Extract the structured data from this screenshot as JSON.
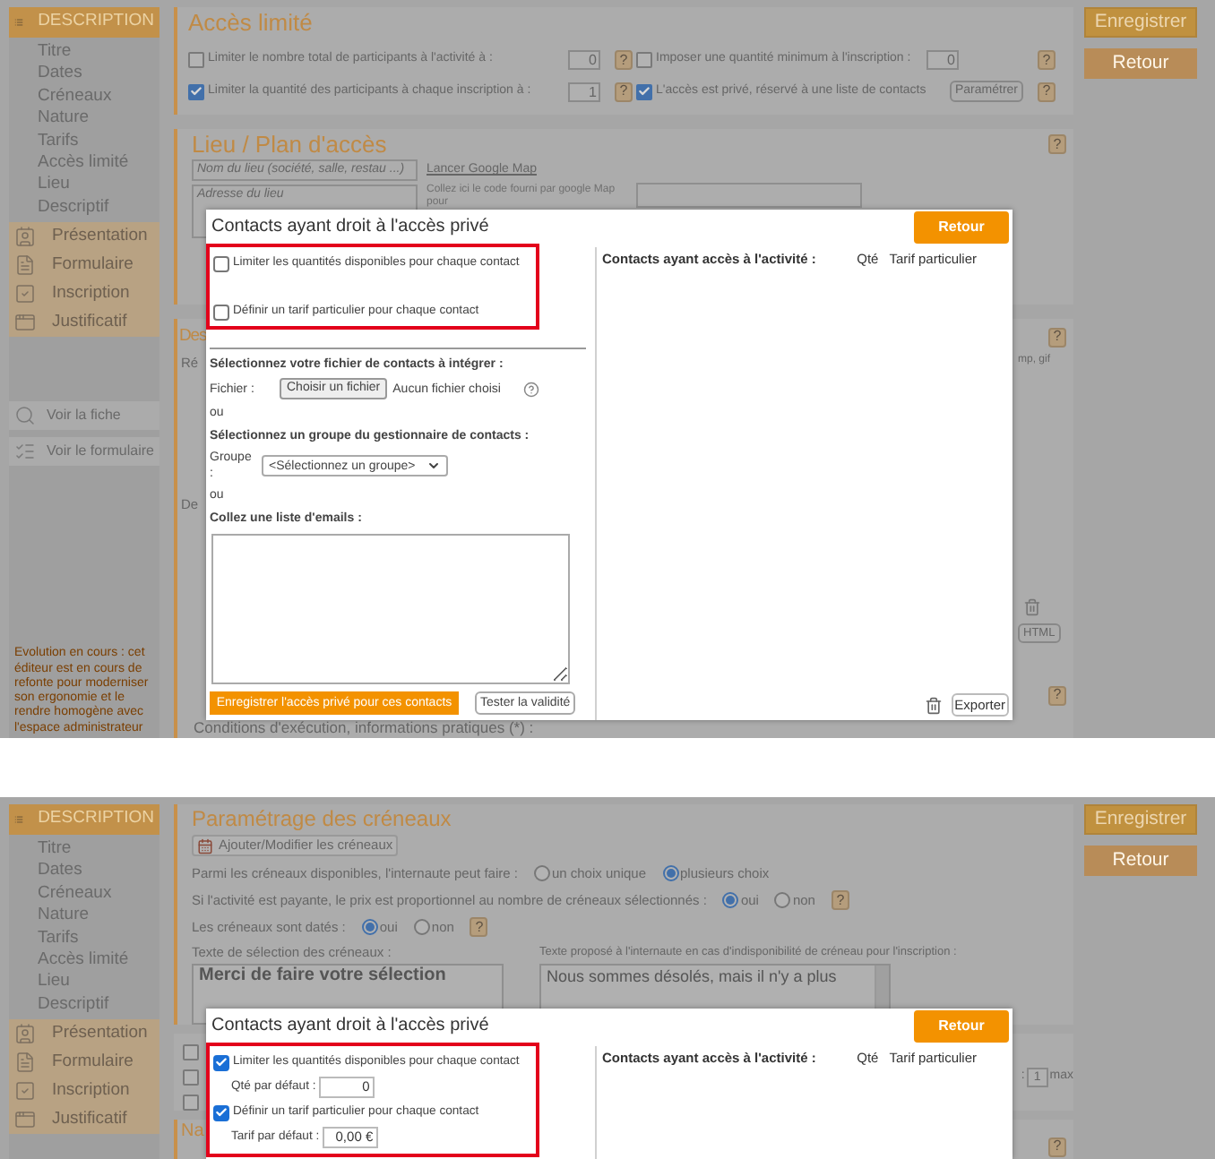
{
  "screens": [
    {
      "kind": "access",
      "sidebar": {
        "header": "DESCRIPTION",
        "items": [
          "Titre",
          "Dates",
          "Créneaux",
          "Nature",
          "Tarifs",
          "Accès limité",
          "Lieu",
          "Descriptif"
        ],
        "sections": [
          {
            "label": "Présentation",
            "kind": "card"
          },
          {
            "label": "Formulaire",
            "kind": "file"
          },
          {
            "label": "Inscription",
            "kind": "check"
          },
          {
            "label": "Justificatif",
            "kind": "window"
          }
        ],
        "links": [
          {
            "label": "Voir la fiche",
            "kind": "search"
          },
          {
            "label": "Voir le formulaire",
            "kind": "form"
          }
        ],
        "notice": "Evolution en cours : cet éditeur est en cours de refonte pour moderniser son ergonomie et le rendre homogène avec l'espace administrateur"
      },
      "main": {
        "limits": {
          "title": "Accès limité",
          "fields": [
            {
              "label": "Limiter le nombre total de participants à l'activité à :",
              "checked": false,
              "value": "0",
              "help": "?"
            },
            {
              "label": "Imposer une quantité minimum à l'inscription :",
              "checked": false,
              "value": "0",
              "help": "?"
            },
            {
              "label": "Limiter la quantité des participants à chaque inscription à :",
              "checked": true,
              "value": "1",
              "help": "?"
            },
            {
              "label": "L'accès est privé, réservé à une liste de contacts",
              "checked": true,
              "button": "Paramétrer",
              "help": "?"
            }
          ]
        },
        "place": {
          "title": "Lieu / Plan d'accès",
          "help": "?",
          "name_placeholder": "Nom du lieu (société, salle, restau ...)",
          "address_placeholder": "Adresse du lieu",
          "map_link": "Lancer Google Map",
          "map_hint": "Collez ici le code fourni par google Map pour"
        },
        "description": {
          "title": "Des",
          "help": "?",
          "labels": [
            "Ré",
            "De"
          ],
          "formats": "mp, gif",
          "html_button": "HTML",
          "help_2": "?",
          "footer": "Conditions d'exécution, informations pratiques (*) :"
        }
      },
      "actions": [
        "Enregistrer",
        "Retour"
      ],
      "modal": {
        "title": "Contacts ayant droit à l'accès privé",
        "options": [
          {
            "label": "Limiter les quantités disponibles pour chaque contact",
            "checked": false
          },
          {
            "label": "Définir un tarif particulier pour chaque contact",
            "checked": false
          }
        ],
        "import": {
          "file_title": "Sélectionnez votre fichier de contacts à intégrer :",
          "file_label": "Fichier :",
          "file_button": "Choisir un fichier",
          "file_status": "Aucun fichier choisi",
          "or_1": "ou",
          "group_title": "Sélectionnez un groupe du gestionnaire de contacts :",
          "group_label": "Groupe :",
          "group_value": "<Sélectionnez un groupe>",
          "or_2": "ou",
          "emails_title": "Collez une liste d'emails :",
          "save_button": "Enregistrer l'accès privé pour ces contacts",
          "test_button": "Tester la validité"
        },
        "close": "Retour",
        "list_title": "Contacts ayant accès à l'activité :",
        "columns": [
          "Qté",
          "Tarif particulier"
        ],
        "export": "Exporter"
      }
    },
    {
      "kind": "slots",
      "sidebar": {
        "header": "DESCRIPTION",
        "items": [
          "Titre",
          "Dates",
          "Créneaux",
          "Nature",
          "Tarifs",
          "Accès limité",
          "Lieu",
          "Descriptif"
        ],
        "sections": [
          {
            "label": "Présentation",
            "kind": "card"
          },
          {
            "label": "Formulaire",
            "kind": "file"
          },
          {
            "label": "Inscription",
            "kind": "check"
          },
          {
            "label": "Justificatif",
            "kind": "window"
          }
        ]
      },
      "main": {
        "slots": {
          "title": "Paramétrage des créneaux",
          "edit_button": "Ajouter/Modifier les créneaux",
          "choices": [
            {
              "label": "Parmi les créneaux disponibles, l'internaute peut faire :",
              "options": [
                {
                  "label": "un choix unique",
                  "selected": false
                },
                {
                  "label": "plusieurs choix",
                  "selected": true
                }
              ]
            },
            {
              "label": "Si l'activité est payante, le prix est proportionnel au nombre de créneaux sélectionnés :",
              "options": [
                {
                  "label": "oui",
                  "selected": true
                },
                {
                  "label": "non",
                  "selected": false
                }
              ],
              "help": "?"
            },
            {
              "label": "Les créneaux sont datés :",
              "options": [
                {
                  "label": "oui",
                  "selected": true
                },
                {
                  "label": "non",
                  "selected": false
                }
              ],
              "help": "?"
            }
          ],
          "selection_text": {
            "label": "Texte de sélection des créneaux :",
            "value": "Merci de faire votre sélection"
          },
          "unavailable_text": {
            "label": "Texte proposé à l'internaute en cas d'indisponibilité de créneau pour l'inscription :",
            "value": "Nous sommes désolés, mais il n'y a plus"
          }
        },
        "options_card": {
          "checkboxes": [
            {
              "checked": false
            },
            {
              "checked": false
            },
            {
              "checked": false
            }
          ],
          "max_prefix": ":",
          "max_value": "1",
          "max_label": "max",
          "help": "?"
        },
        "next_title": "Na"
      },
      "actions": [
        "Enregistrer",
        "Retour"
      ],
      "modal": {
        "title": "Contacts ayant droit à l'accès privé",
        "options": [
          {
            "label": "Limiter les quantités disponibles pour chaque contact",
            "checked": true,
            "default_label": "Qté par défaut :",
            "default_value": "0"
          },
          {
            "label": "Définir un tarif particulier pour chaque contact",
            "checked": true,
            "default_label": "Tarif par défaut :",
            "default_value": "0,00 €"
          }
        ],
        "close": "Retour",
        "list_title": "Contacts ayant accès à l'activité :",
        "columns": [
          "Qté",
          "Tarif particulier"
        ]
      }
    }
  ]
}
